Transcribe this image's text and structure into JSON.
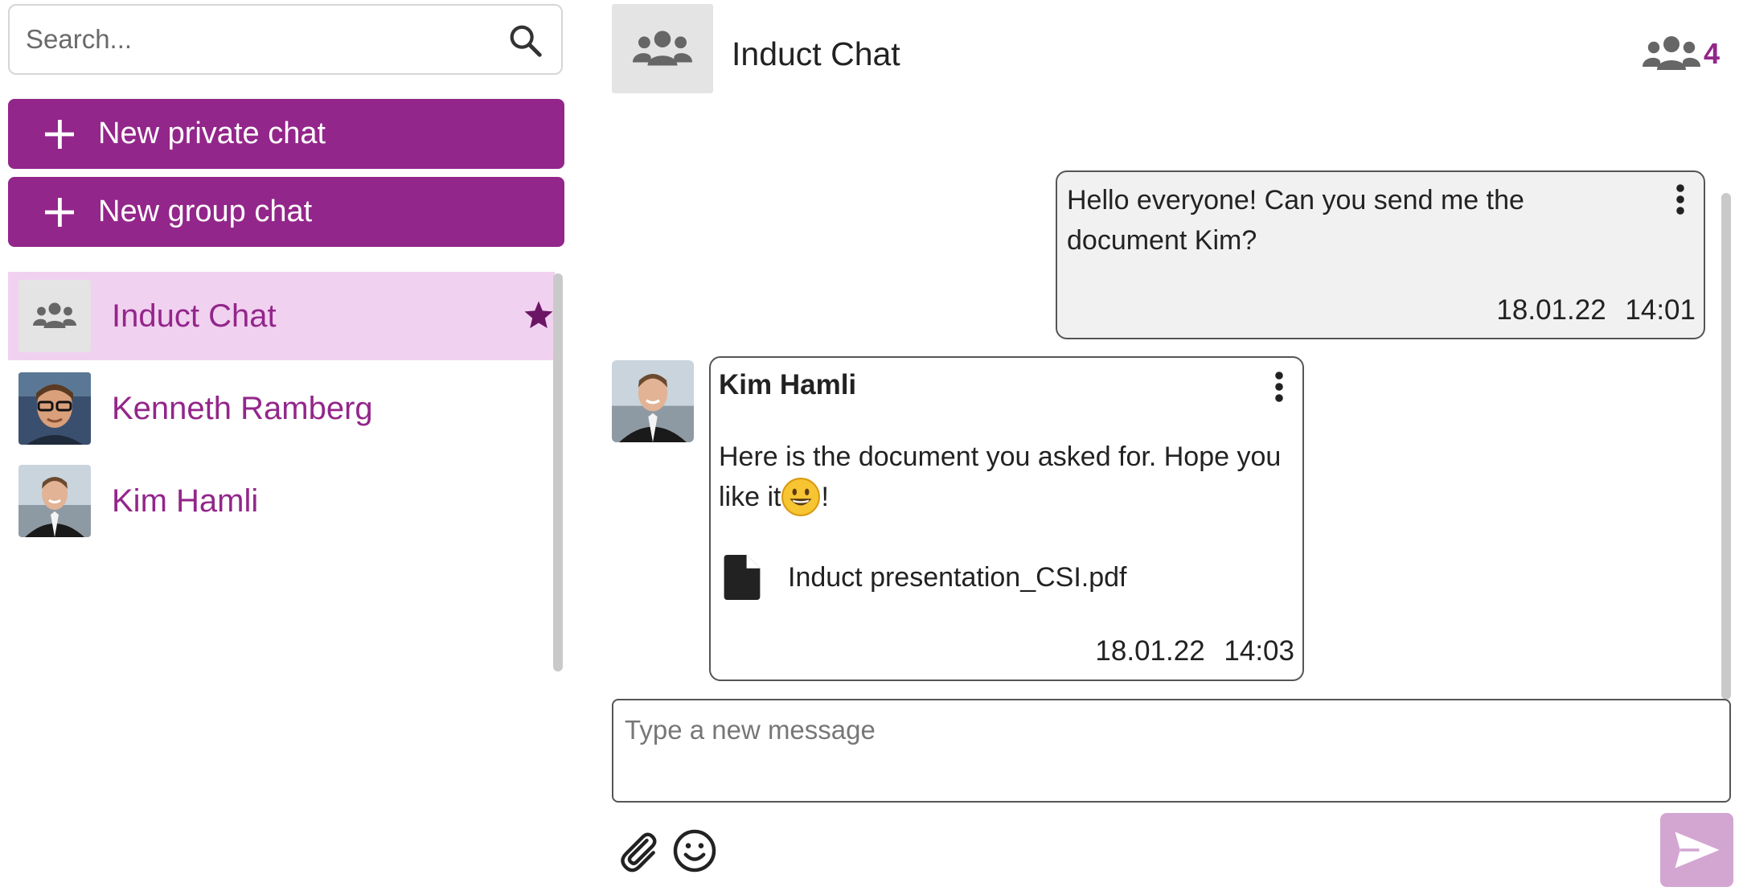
{
  "sidebar": {
    "search": {
      "placeholder": "Search...",
      "value": ""
    },
    "new_private_chat_label": "New private chat",
    "new_group_chat_label": "New group chat",
    "chats": [
      {
        "name": "Induct Chat",
        "type": "group",
        "active": true,
        "starred": true
      },
      {
        "name": "Kenneth Ramberg",
        "type": "private",
        "active": false,
        "starred": false
      },
      {
        "name": "Kim Hamli",
        "type": "private",
        "active": false,
        "starred": false
      }
    ]
  },
  "header": {
    "title": "Induct Chat",
    "member_count": "4"
  },
  "messages": [
    {
      "direction": "outgoing",
      "text": "Hello everyone! Can you send me the document Kim?",
      "date": "18.01.22",
      "time": "14:01"
    },
    {
      "direction": "incoming",
      "sender": "Kim Hamli",
      "text_before_emoji": "Here is the document you asked for. Hope you like it",
      "text_after_emoji": "!",
      "emoji": "grinning-face",
      "attachment": "Induct presentation_CSI.pdf",
      "date": "18.01.22",
      "time": "14:03"
    }
  ],
  "composer": {
    "placeholder": "Type a new message",
    "value": ""
  },
  "colors": {
    "brand": "#93268a",
    "active_chat_bg": "#f1d1f0",
    "send_button": "#d3a6d2",
    "outgoing_bubble": "#f1f1f1"
  },
  "icons": [
    "search-icon",
    "plus-icon",
    "group-icon",
    "star-icon",
    "kebab-menu-icon",
    "file-icon",
    "paperclip-icon",
    "emoji-icon",
    "send-icon"
  ]
}
